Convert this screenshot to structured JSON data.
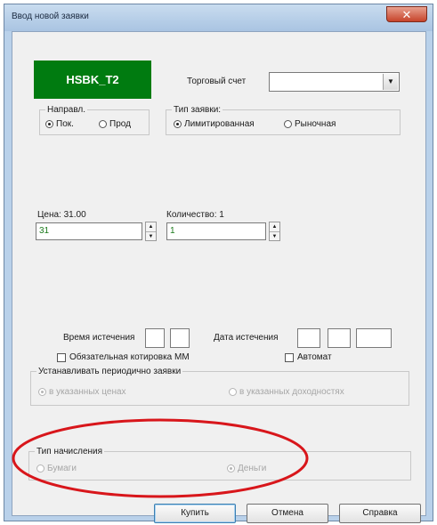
{
  "window": {
    "title": "Ввод новой заявки",
    "close_glyph": "✕"
  },
  "class_code": "HSBK_T2",
  "account": {
    "label": "Торговый счет",
    "value": "",
    "arrow_glyph": "▼"
  },
  "direction": {
    "legend": "Направл.",
    "options": [
      {
        "label": "Пок.",
        "checked": true
      },
      {
        "label": "Прод",
        "checked": false
      }
    ]
  },
  "order_type": {
    "legend": "Тип заявки:",
    "options": [
      {
        "label": "Лимитированная",
        "checked": true
      },
      {
        "label": "Рыночная",
        "checked": false
      }
    ]
  },
  "price": {
    "label": "Цена: 31.00",
    "value": "31"
  },
  "quantity": {
    "label": "Количество: 1",
    "value": "1"
  },
  "spin_glyphs": {
    "up": "▲",
    "down": "▼"
  },
  "expiry": {
    "time_label": "Время истечения",
    "date_label": "Дата истечения"
  },
  "mm_checkbox": {
    "label": "Обязательная котировка ММ",
    "checked": false
  },
  "auto_checkbox": {
    "label": "Автомат",
    "checked": false
  },
  "periodic": {
    "legend": "Устанавливать периодично заявки",
    "options": [
      {
        "label": "в указанных ценах",
        "checked": true
      },
      {
        "label": "в указанных доходностях",
        "checked": false
      }
    ]
  },
  "charge_type": {
    "legend": "Тип начисления",
    "options": [
      {
        "label": "Бумаги",
        "checked": false
      },
      {
        "label": "Деньги",
        "checked": true
      }
    ]
  },
  "buttons": {
    "buy": "Купить",
    "cancel": "Отмена",
    "help": "Справка"
  },
  "annotation_color": "#d8161b"
}
